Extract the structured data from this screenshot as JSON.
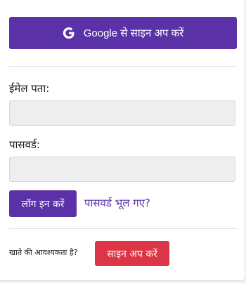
{
  "google_signup": {
    "label": "Google से साइन अप करें",
    "icon": "google-g-icon"
  },
  "login_form": {
    "email_label": "ईमेल पता:",
    "email_value": "",
    "password_label": "पासवर्ड:",
    "password_value": "",
    "login_button": "लॉग इन करें",
    "forgot_password": "पासवर्ड भूल गए?"
  },
  "signup_section": {
    "prompt": "खाते की आवश्यकता है?",
    "signup_button": "साइन अप करें"
  },
  "colors": {
    "primary": "#5a31a7",
    "danger": "#dc3545",
    "input_bg": "#eeeeee"
  }
}
